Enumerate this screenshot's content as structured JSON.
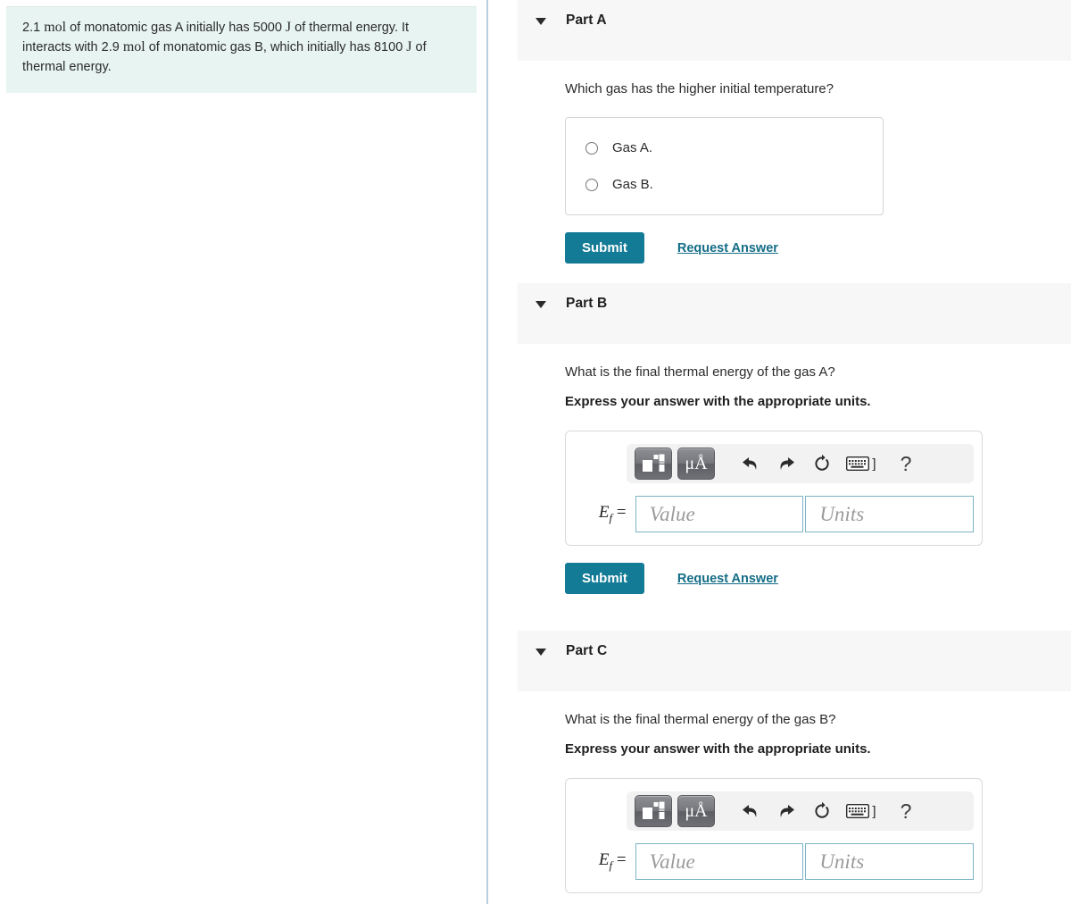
{
  "problem": {
    "segments": [
      {
        "text": "2.1 ",
        "type": "plain"
      },
      {
        "text": "mol",
        "type": "unit"
      },
      {
        "text": " of monatomic gas A initially has 5000 ",
        "type": "plain"
      },
      {
        "text": "J",
        "type": "unit"
      },
      {
        "text": " of thermal energy. It interacts with 2.9 ",
        "type": "plain"
      },
      {
        "text": "mol",
        "type": "unit"
      },
      {
        "text": " of monatomic gas B, which initially has 8100 ",
        "type": "plain"
      },
      {
        "text": "J",
        "type": "unit"
      },
      {
        "text": " of thermal energy.",
        "type": "plain"
      }
    ],
    "full_text": "2.1 mol of monatomic gas A initially has 5000 J of thermal energy. It interacts with 2.9 mol of monatomic gas B, which initially has 8100 J of thermal energy."
  },
  "colors": {
    "problem_background": "#e7f4f2",
    "submit_button": "#147b96",
    "link": "#146d86",
    "part_header_background": "#f7f7f7",
    "divider": "#b9cee0",
    "input_border": "#7bb3c4"
  },
  "parts": {
    "a": {
      "title": "Part A",
      "caret": "caret-down-icon",
      "question": "Which gas has the higher initial temperature?",
      "choices": [
        {
          "label": "Gas A.",
          "selected": false
        },
        {
          "label": "Gas B.",
          "selected": false
        }
      ],
      "submit_label": "Submit",
      "request_answer_label": "Request Answer"
    },
    "b": {
      "title": "Part B",
      "caret": "caret-down-icon",
      "question": "What is the final thermal energy of the gas A?",
      "instruction": "Express your answer with the appropriate units.",
      "answer": {
        "label_base": "E",
        "label_sub": "f",
        "label_equals": "=",
        "value_placeholder": "Value",
        "units_placeholder": "Units",
        "value": "",
        "units": "",
        "toolbar": {
          "template_button": "template-icon",
          "units_button": "μÅ",
          "undo": "undo-icon",
          "redo": "redo-icon",
          "reset": "reset-icon",
          "keyboard": "keyboard-icon",
          "keyboard_bracket": "]",
          "help": "?"
        }
      },
      "submit_label": "Submit",
      "request_answer_label": "Request Answer"
    },
    "c": {
      "title": "Part C",
      "caret": "caret-down-icon",
      "question": "What is the final thermal energy of the gas B?",
      "instruction": "Express your answer with the appropriate units.",
      "answer": {
        "label_base": "E",
        "label_sub": "f",
        "label_equals": "=",
        "value_placeholder": "Value",
        "units_placeholder": "Units",
        "value": "",
        "units": "",
        "toolbar": {
          "template_button": "template-icon",
          "units_button": "μÅ",
          "undo": "undo-icon",
          "redo": "redo-icon",
          "reset": "reset-icon",
          "keyboard": "keyboard-icon",
          "keyboard_bracket": "]",
          "help": "?"
        }
      }
    }
  }
}
